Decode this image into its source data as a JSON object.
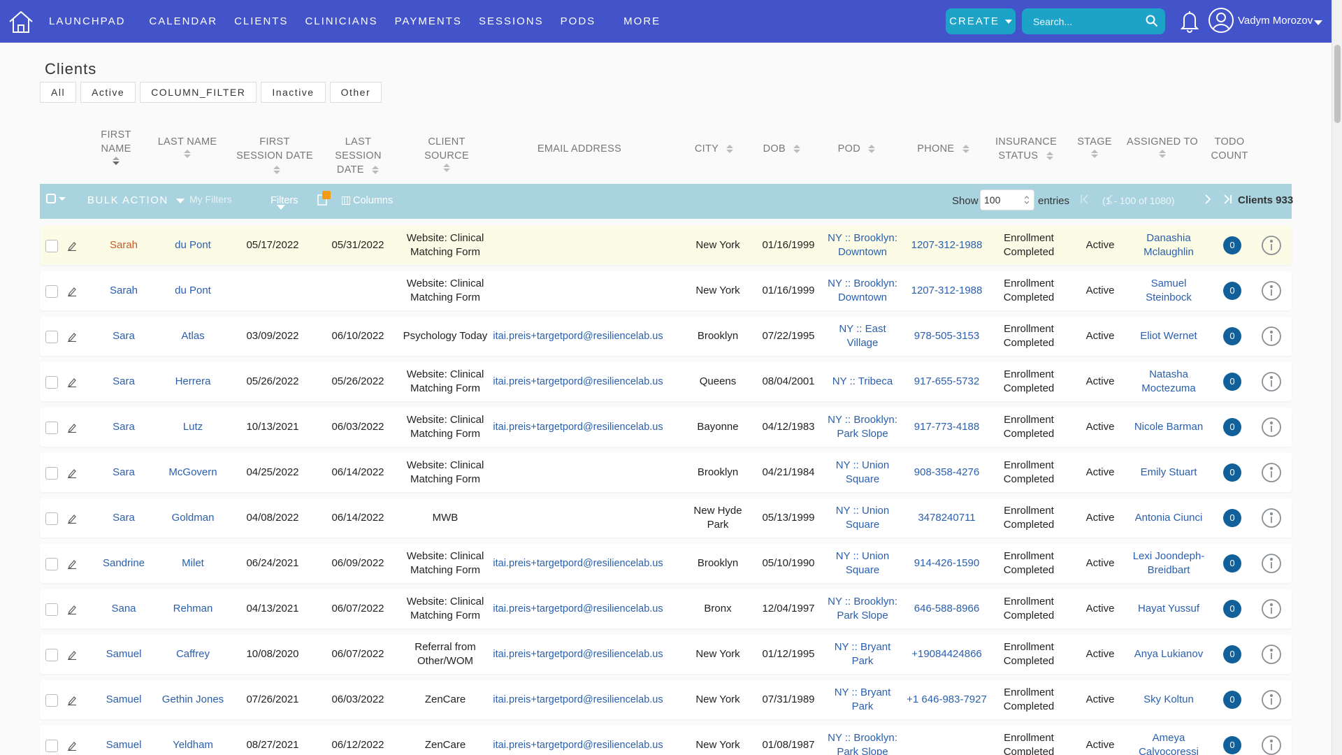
{
  "nav": {
    "items": [
      "LAUNCHPAD",
      "CALENDAR",
      "CLIENTS",
      "CLINICIANS",
      "PAYMENTS",
      "SESSIONS",
      "PODS"
    ],
    "more": "MORE",
    "create": "CREATE",
    "search_placeholder": "Search...",
    "user": "Vadym Morozov"
  },
  "page_title": "Clients",
  "filter_tabs": [
    "All",
    "Active",
    "COLUMN_FILTER",
    "Inactive",
    "Other"
  ],
  "headers": {
    "first_name": "FIRST NAME",
    "last_name": "LAST NAME",
    "first_session": "FIRST SESSION DATE",
    "last_session": "LAST SESSION DATE",
    "source": "CLIENT SOURCE",
    "email": "EMAIL ADDRESS",
    "city": "CITY",
    "dob": "DOB",
    "pod": "POD",
    "phone": "PHONE",
    "insurance": "INSURANCE STATUS",
    "stage": "STAGE",
    "assigned": "ASSIGNED TO",
    "todo": "TODO COUNT"
  },
  "toolbar": {
    "bulk_action": "BULK ACTION",
    "my_filters": "My Filters",
    "filters": "Filters",
    "columns": "Columns",
    "show": "Show",
    "entries_value": "100",
    "entries": "entries",
    "range": "(1 - 100 of 1080)",
    "count": "Clients 933"
  },
  "colors": {
    "nav_bg": "#4353c9",
    "accent": "#1ea3c8",
    "toolbar_bg": "#a9d3df",
    "link": "#2a5fae",
    "highlight_row": "#fcfce6",
    "todo_badge": "#11609a",
    "filter_badge": "#f39c12"
  },
  "rows": [
    {
      "first": "Sarah",
      "last": "du Pont",
      "fs": "05/17/2022",
      "ls": "05/31/2022",
      "source": "Website: Clinical Matching Form",
      "email": "",
      "city": "New York",
      "dob": "01/16/1999",
      "pod": "NY :: Brooklyn: Downtown",
      "phone": "1207-312-1988",
      "insurance": "Enrollment Completed",
      "stage": "Active",
      "assigned": "Danashia Mclaughlin",
      "todo": "0"
    },
    {
      "first": "Sarah",
      "last": "du Pont",
      "fs": "",
      "ls": "",
      "source": "Website: Clinical Matching Form",
      "email": "",
      "city": "New York",
      "dob": "01/16/1999",
      "pod": "NY :: Brooklyn: Downtown",
      "phone": "1207-312-1988",
      "insurance": "Enrollment Completed",
      "stage": "Active",
      "assigned": "Samuel Steinbock",
      "todo": "0"
    },
    {
      "first": "Sara",
      "last": "Atlas",
      "fs": "03/09/2022",
      "ls": "06/10/2022",
      "source": "Psychology Today",
      "email": "itai.preis+targetpord@resiliencelab.us",
      "city": "Brooklyn",
      "dob": "07/22/1995",
      "pod": "NY :: East Village",
      "phone": "978-505-3153",
      "insurance": "Enrollment Completed",
      "stage": "Active",
      "assigned": "Eliot Wernet",
      "todo": "0"
    },
    {
      "first": "Sara",
      "last": "Herrera",
      "fs": "05/26/2022",
      "ls": "05/26/2022",
      "source": "Website: Clinical Matching Form",
      "email": "itai.preis+targetpord@resiliencelab.us",
      "city": "Queens",
      "dob": "08/04/2001",
      "pod": "NY :: Tribeca",
      "phone": "917-655-5732",
      "insurance": "Enrollment Completed",
      "stage": "Active",
      "assigned": "Natasha Moctezuma",
      "todo": "0"
    },
    {
      "first": "Sara",
      "last": "Lutz",
      "fs": "10/13/2021",
      "ls": "06/03/2022",
      "source": "Website: Clinical Matching Form",
      "email": "itai.preis+targetpord@resiliencelab.us",
      "city": "Bayonne",
      "dob": "04/12/1983",
      "pod": "NY :: Brooklyn: Park Slope",
      "phone": "917-773-4188",
      "insurance": "Enrollment Completed",
      "stage": "Active",
      "assigned": "Nicole Barman",
      "todo": "0"
    },
    {
      "first": "Sara",
      "last": "McGovern",
      "fs": "04/25/2022",
      "ls": "06/14/2022",
      "source": "Website: Clinical Matching Form",
      "email": "",
      "city": "Brooklyn",
      "dob": "04/21/1984",
      "pod": "NY :: Union Square",
      "phone": "908-358-4276",
      "insurance": "Enrollment Completed",
      "stage": "Active",
      "assigned": "Emily Stuart",
      "todo": "0"
    },
    {
      "first": "Sara",
      "last": "Goldman",
      "fs": "04/08/2022",
      "ls": "06/14/2022",
      "source": "MWB",
      "email": "",
      "city": "New Hyde Park",
      "dob": "05/13/1999",
      "pod": "NY :: Union Square",
      "phone": "3478240711",
      "insurance": "Enrollment Completed",
      "stage": "Active",
      "assigned": "Antonia Ciunci",
      "todo": "0"
    },
    {
      "first": "Sandrine",
      "last": "Milet",
      "fs": "06/24/2021",
      "ls": "06/09/2022",
      "source": "Website: Clinical Matching Form",
      "email": "itai.preis+targetpord@resiliencelab.us",
      "city": "Brooklyn",
      "dob": "05/10/1990",
      "pod": "NY :: Union Square",
      "phone": "914-426-1590",
      "insurance": "Enrollment Completed",
      "stage": "Active",
      "assigned": "Lexi Joondeph-Breidbart",
      "todo": "0"
    },
    {
      "first": "Sana",
      "last": "Rehman",
      "fs": "04/13/2021",
      "ls": "06/07/2022",
      "source": "Website: Clinical Matching Form",
      "email": "itai.preis+targetpord@resiliencelab.us",
      "city": "Bronx",
      "dob": "12/04/1997",
      "pod": "NY :: Brooklyn: Park Slope",
      "phone": "646-588-8966",
      "insurance": "Enrollment Completed",
      "stage": "Active",
      "assigned": "Hayat Yussuf",
      "todo": "0"
    },
    {
      "first": "Samuel",
      "last": "Caffrey",
      "fs": "10/08/2020",
      "ls": "06/07/2022",
      "source": "Referral from Other/WOM",
      "email": "itai.preis+targetpord@resiliencelab.us",
      "city": "New York",
      "dob": "01/12/1995",
      "pod": "NY :: Bryant Park",
      "phone": "+19084424866",
      "insurance": "Enrollment Completed",
      "stage": "Active",
      "assigned": "Anya Lukianov",
      "todo": "0"
    },
    {
      "first": "Samuel",
      "last": "Gethin Jones",
      "fs": "07/26/2021",
      "ls": "06/03/2022",
      "source": "ZenCare",
      "email": "itai.preis+targetpord@resiliencelab.us",
      "city": "New York",
      "dob": "07/31/1989",
      "pod": "NY :: Bryant Park",
      "phone": "+1 646-983-7927",
      "insurance": "Enrollment Completed",
      "stage": "Active",
      "assigned": "Sky Koltun",
      "todo": "0"
    },
    {
      "first": "Samuel",
      "last": "Yeldham",
      "fs": "08/27/2021",
      "ls": "06/12/2022",
      "source": "ZenCare",
      "email": "itai.preis+targetpord@resiliencelab.us",
      "city": "New York",
      "dob": "01/08/1987",
      "pod": "NY :: Brooklyn: Park Slope",
      "phone": "",
      "insurance": "Enrollment Completed",
      "stage": "Active",
      "assigned": "Ameya Calvocoressi",
      "todo": "0"
    }
  ]
}
